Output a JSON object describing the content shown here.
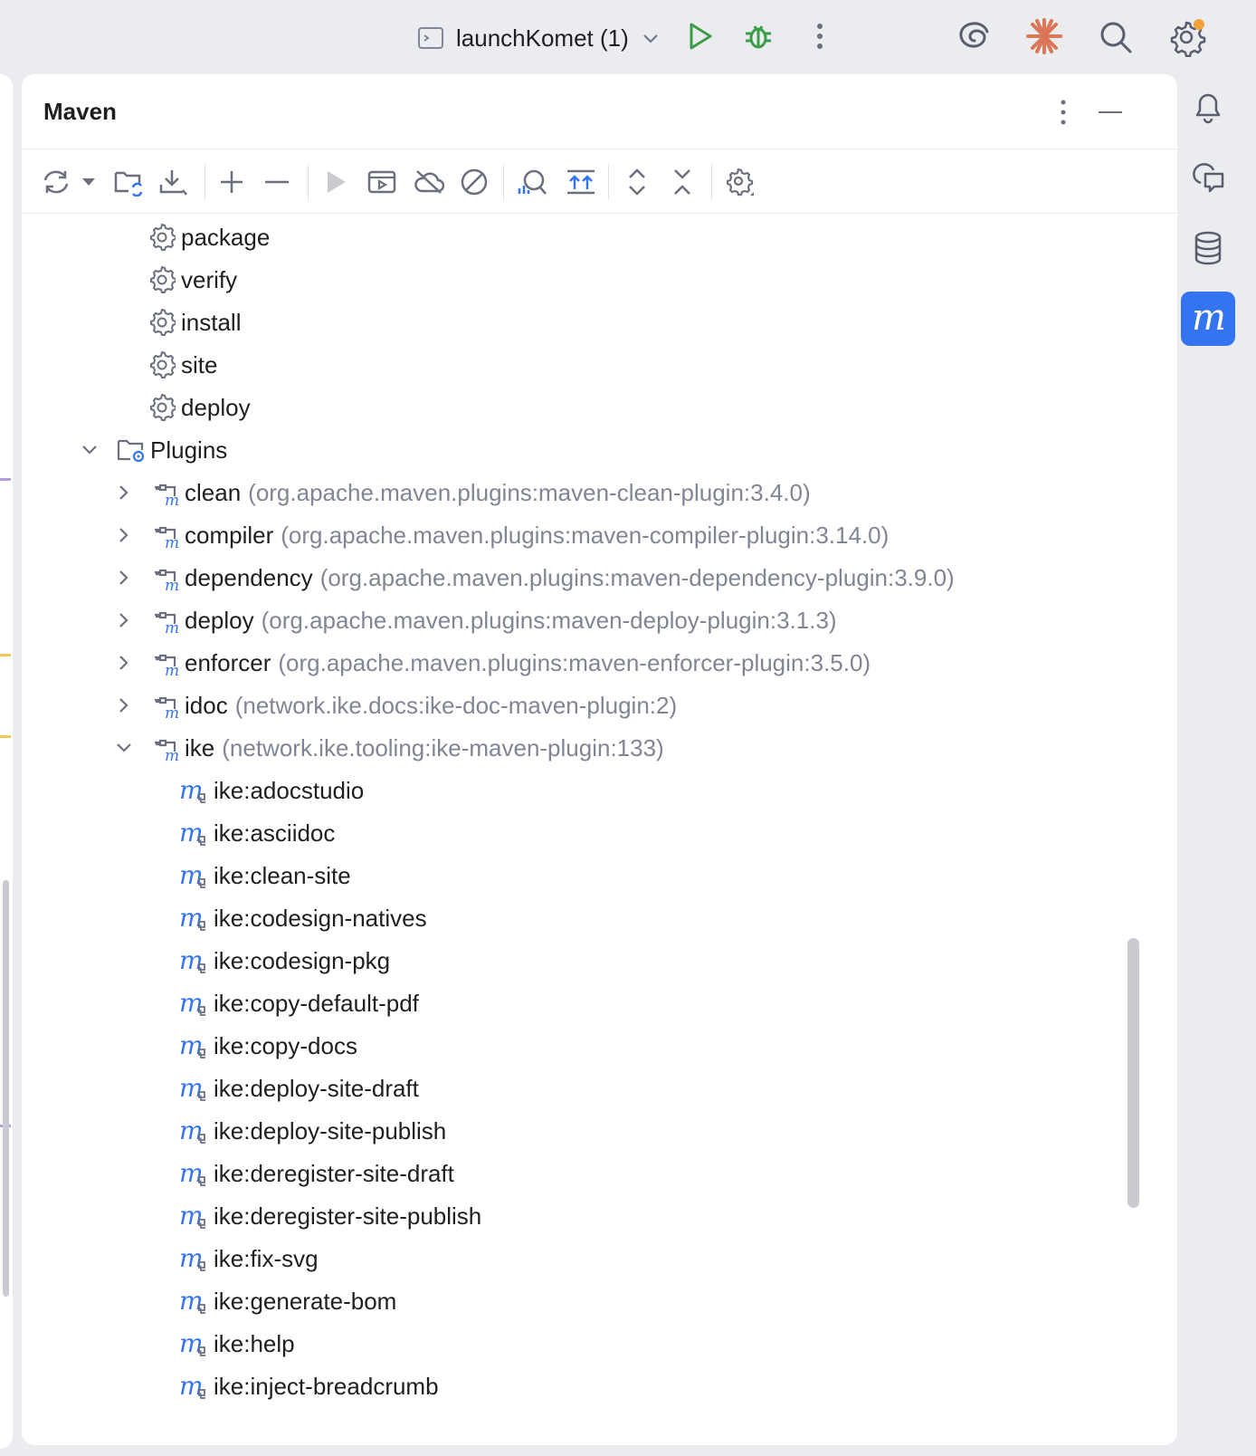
{
  "topbar": {
    "run_config_label": "launchKomet (1)",
    "icons": [
      "terminal-icon",
      "chevron-down-icon",
      "run-icon",
      "debug-icon",
      "more-vertical-icon",
      "ai-assistant-icon",
      "claude-icon",
      "search-icon",
      "settings-icon"
    ],
    "accent_run": "#3c9c48",
    "accent_update_dot": "#f3a33a"
  },
  "panel": {
    "title": "Maven",
    "toolbar_icons": [
      "reload-icon",
      "dropdown-icon",
      "reimport-folder-icon",
      "download-icon",
      "add-icon",
      "remove-icon",
      "run-goal-icon",
      "run-config-icon",
      "offline-icon",
      "skip-tests-icon",
      "analyze-dependencies-icon",
      "show-basic-phases-icon",
      "expand-all-icon",
      "collapse-all-icon",
      "maven-settings-icon"
    ]
  },
  "tree": {
    "lifecycle": [
      "package",
      "verify",
      "install",
      "site",
      "deploy"
    ],
    "plugins_label": "Plugins",
    "plugins": [
      {
        "name": "clean",
        "coord": "(org.apache.maven.plugins:maven-clean-plugin:3.4.0)",
        "expanded": false
      },
      {
        "name": "compiler",
        "coord": "(org.apache.maven.plugins:maven-compiler-plugin:3.14.0)",
        "expanded": false
      },
      {
        "name": "dependency",
        "coord": "(org.apache.maven.plugins:maven-dependency-plugin:3.9.0)",
        "expanded": false
      },
      {
        "name": "deploy",
        "coord": "(org.apache.maven.plugins:maven-deploy-plugin:3.1.3)",
        "expanded": false
      },
      {
        "name": "enforcer",
        "coord": "(org.apache.maven.plugins:maven-enforcer-plugin:3.5.0)",
        "expanded": false
      },
      {
        "name": "idoc",
        "coord": "(network.ike.docs:ike-doc-maven-plugin:2)",
        "expanded": false
      },
      {
        "name": "ike",
        "coord": "(network.ike.tooling:ike-maven-plugin:133)",
        "expanded": true
      }
    ],
    "ike_goals": [
      "ike:adocstudio",
      "ike:asciidoc",
      "ike:clean-site",
      "ike:codesign-natives",
      "ike:codesign-pkg",
      "ike:copy-default-pdf",
      "ike:copy-docs",
      "ike:deploy-site-draft",
      "ike:deploy-site-publish",
      "ike:deregister-site-draft",
      "ike:deregister-site-publish",
      "ike:fix-svg",
      "ike:generate-bom",
      "ike:help",
      "ike:inject-breadcrumb"
    ]
  },
  "right_bar": {
    "icons": [
      "notifications-icon",
      "ai-chat-icon",
      "database-icon",
      "maven-icon"
    ],
    "active": "maven-icon",
    "active_color": "#3574f0"
  }
}
